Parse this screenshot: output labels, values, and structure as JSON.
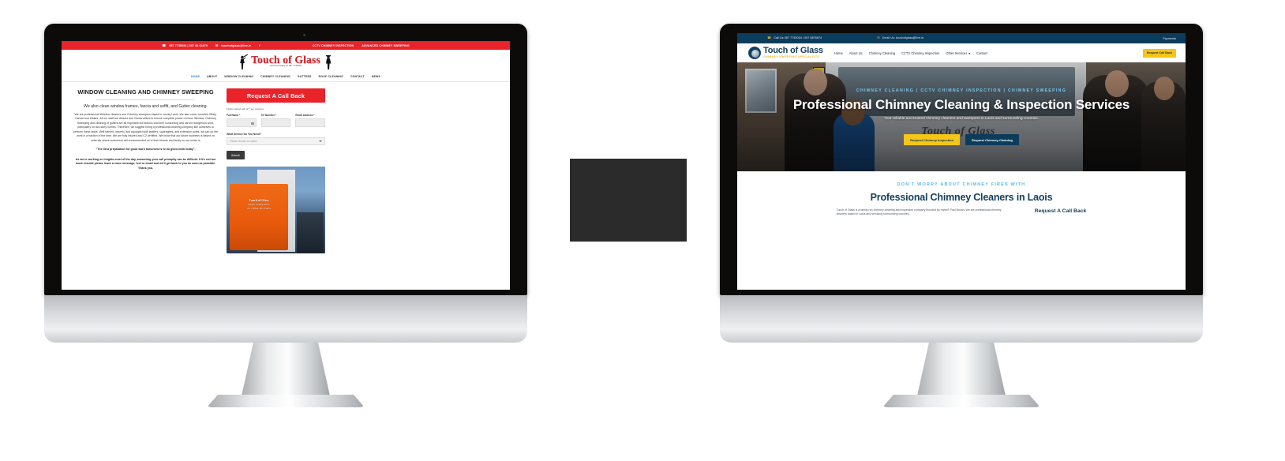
{
  "scene": {
    "background": "#ffffff",
    "placeholder_color": "#2b2b2b"
  },
  "old_site": {
    "topbar": {
      "phone_icon": "phone-icon",
      "phone": "057 7735054 | 087 66 62879",
      "mail_icon": "mail-icon",
      "email": "touchofglass@live.ie",
      "facebook_icon": "facebook-icon",
      "link_1": "CCTV CHIMNEY INSPECTION",
      "link_2": "ADVANCED CHIMNEY SWEEPING",
      "bg": "#e8232a"
    },
    "logo": {
      "title": "Touch of Glass",
      "tagline": "Call Paul Today on 087 7735054"
    },
    "nav": [
      {
        "label": "HOME",
        "active": true
      },
      {
        "label": "ABOUT",
        "active": false
      },
      {
        "label": "WINDOW CLEANING",
        "active": false
      },
      {
        "label": "CHIMNEY CLEANING",
        "active": false
      },
      {
        "label": "GUTTERS",
        "active": false
      },
      {
        "label": "ROOF CLEANING",
        "active": false
      },
      {
        "label": "CONTACT",
        "active": false
      },
      {
        "label": "NEWS",
        "active": false
      }
    ],
    "content": {
      "heading": "WINDOW CLEANING AND CHIMNEY SWEEPING",
      "lead": "We also clean window frames, fascia and soffit, and Gutter cleaning.",
      "paragraph": "We are professional Window cleaners and Chimney sweepers based in county Laois. We also cover counties Offaly, Carlow and Kildare. All our staff are cleared and Garda vetted to ensure complete peace of mind. Window, Chimney Sweeping and cleaning of gutters are all important but tedious and time consuming and can be dangerous work, particularly on two-story homes. Therefore, we suggest hiring a professional cleaning company like ourselves to perform these tasks. Well trained, insured, and equipped with ladders, squeegees, and extension poles, we can do the work in a fraction of the time. We are fully insured and C2 certified. We know that our future business is based on referrals where customers will recommended us to their friends and family so our motto is",
      "quote": "\"The best preparation for good work tomorrow is to do good work today\".",
      "note": "As we're working on heights most of the day, answering your call promptly can be difficult. If it's not too much trouble please leave a voice message, text or email and we'll get back to you as soon as possible. Thank you."
    },
    "form": {
      "cta_title": "Request A Call Back",
      "required_note": "Fields marked with an * are required",
      "fields": [
        {
          "label": "Full Name *",
          "value": ""
        },
        {
          "label": "Tel Number *",
          "value": ""
        },
        {
          "label": "Email Address *",
          "value": ""
        }
      ],
      "service_label": "What Service Do You Need?",
      "service_placeholder": "Please choose an option",
      "submit_label": "Submit"
    },
    "photo": {
      "van_text": "Touch of Glass",
      "van_sub": "Window Cleaning Service",
      "van_sub2": "057 7735054 / 087 7735054"
    }
  },
  "new_site": {
    "topbar": {
      "phone_icon": "phone-icon",
      "phone": "Call Us 087 7735054 / 057 8876874",
      "mail_icon": "mail-icon",
      "email": "Email Us: touchofglass@live.ie",
      "payments": "Payments",
      "bg": "#0c3c5c"
    },
    "logo": {
      "title": "Touch of Glass",
      "tagline": "CHIMNEY SWEEPING SPECIALISTS",
      "badge_icon": "crest-icon"
    },
    "nav": [
      {
        "label": "Home",
        "has_caret": false
      },
      {
        "label": "About Us",
        "has_caret": false
      },
      {
        "label": "Chimney Cleaning",
        "has_caret": false
      },
      {
        "label": "CCTV Chimney Inspection",
        "has_caret": false
      },
      {
        "label": "Other Services",
        "has_caret": true
      },
      {
        "label": "Contact",
        "has_caret": false
      }
    ],
    "header_cta": "Request Call Back",
    "hero": {
      "eyebrow": "CHIMNEY CLEANING | CCTV CHIMNEY INSPECTION | CHIMNEY SWEEPING",
      "title": "Professional Chimney Cleaning & Inspection Services",
      "subtitle": "Your reliable and trusted chimney cleaners and sweepers in Laois and surrounding counties.",
      "button_primary": "Request Chimney Inspection",
      "button_secondary": "Request Chimney Cleaning",
      "van_logo": "Touch of Glass"
    },
    "below": {
      "eyebrow": "DON'T WORRY ABOUT CHIMNEY FIRES WITH",
      "heading": "Professional Chimney Cleaners in Laois",
      "paragraph": "Touch of Glass is a family-run chimney cleaning and inspection company founded by myself, Paul Brown. We are professional chimney cleaners based in Laois and servicing surrounding counties.",
      "callback_heading": "Request A Call Back"
    }
  }
}
